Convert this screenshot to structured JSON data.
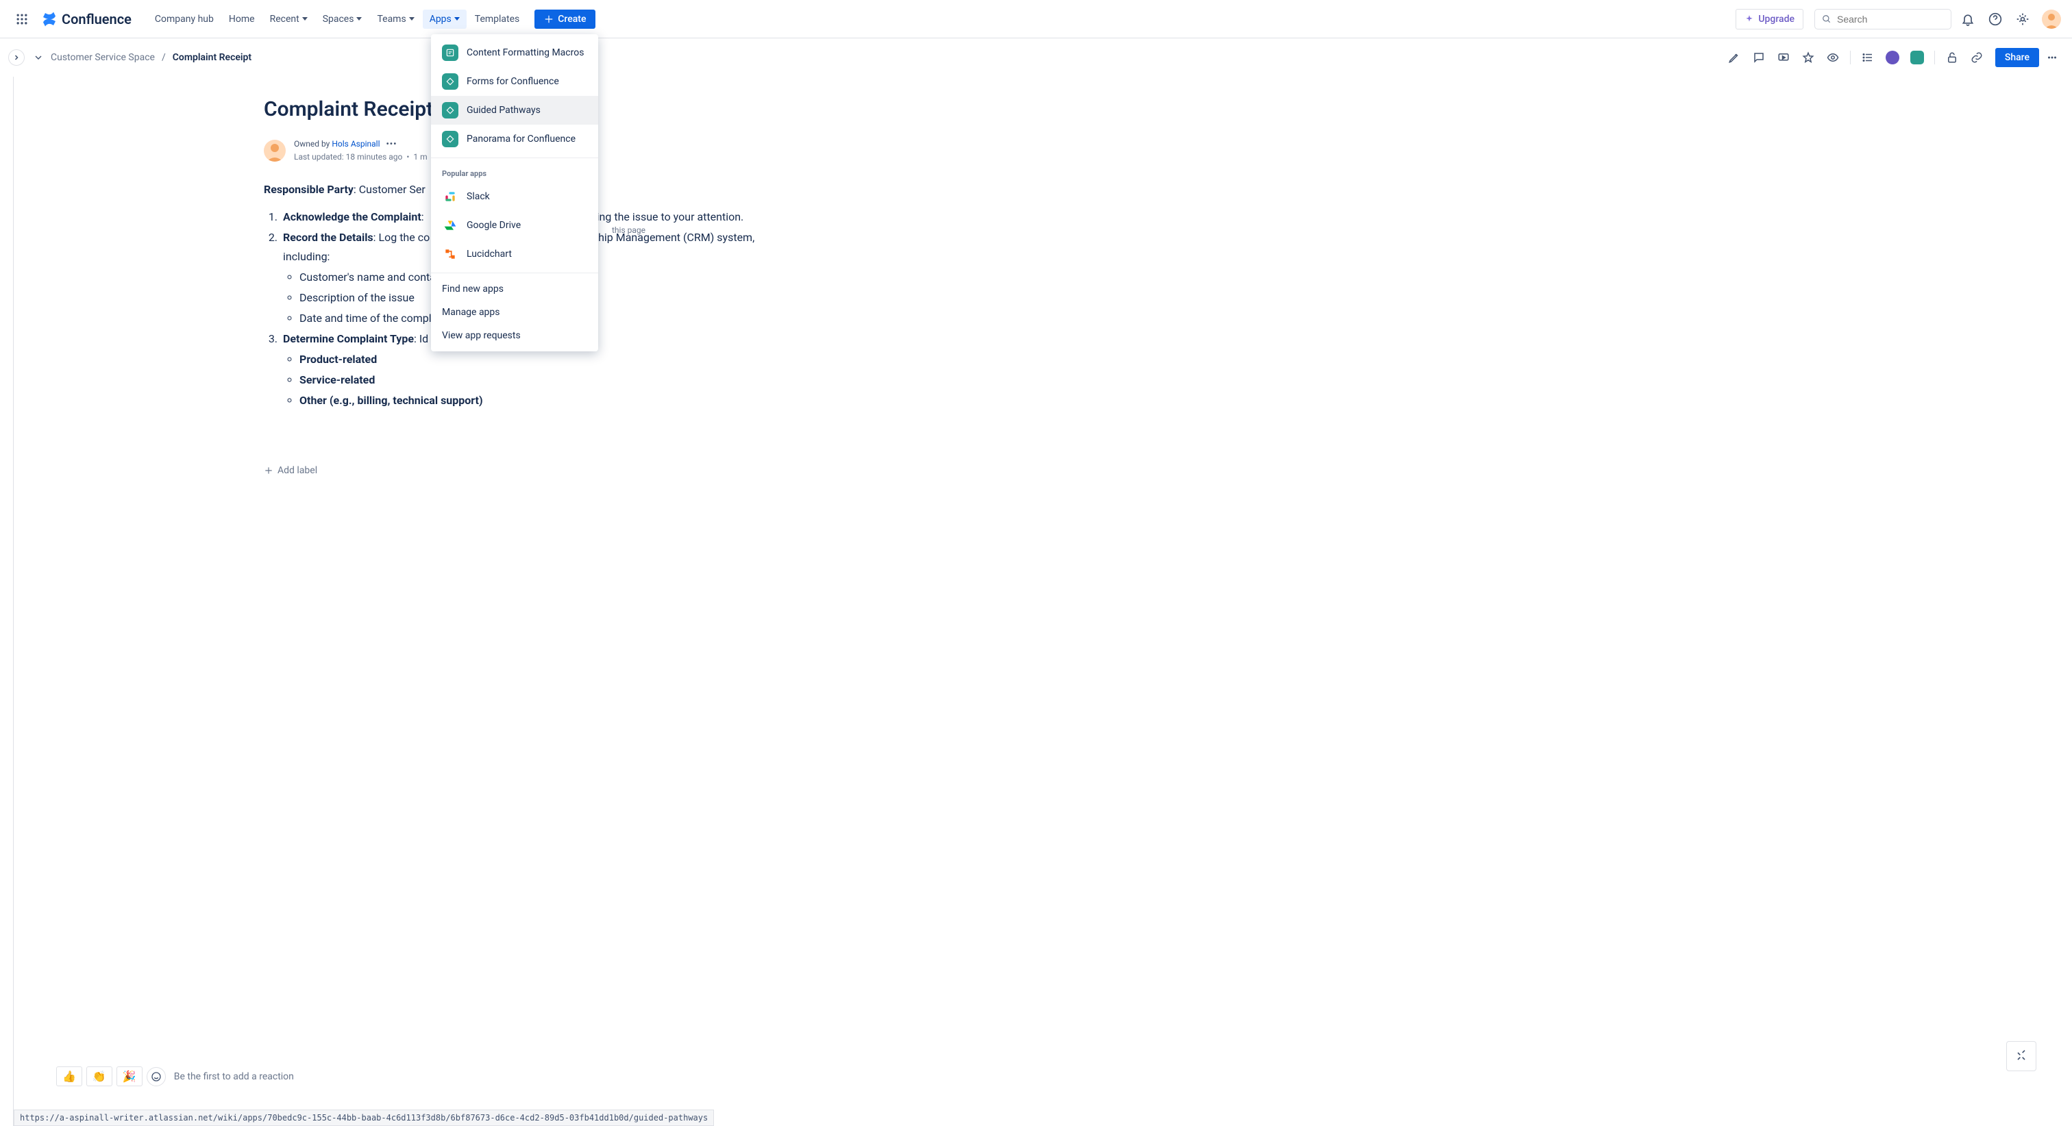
{
  "nav": {
    "logo_text": "Confluence",
    "company_hub": "Company hub",
    "home": "Home",
    "recent": "Recent",
    "spaces": "Spaces",
    "teams": "Teams",
    "apps": "Apps",
    "templates": "Templates",
    "create": "Create",
    "upgrade": "Upgrade",
    "search_placeholder": "Search"
  },
  "breadcrumb": {
    "space": "Customer Service Space",
    "separator": "/",
    "page": "Complaint Receipt"
  },
  "page_actions": {
    "share": "Share"
  },
  "page": {
    "title": "Complaint Receipt",
    "owned_by_prefix": "Owned by ",
    "owner_name": "Hols Aspinall",
    "last_updated": "Last updated: 18 minutes ago",
    "read_time_sep": "•",
    "read_time": "1 m",
    "analytics_suffix": "this page",
    "add_label": "Add label"
  },
  "content": {
    "resp_party_label": "Responsible Party",
    "resp_party_value": ": Customer Ser",
    "item1_label": "Acknowledge the Complaint",
    "item1_tail_visible": ": ",
    "item1_after_menu": "nging the issue to your attention.",
    "item2_label": "Record the Details",
    "item2_tail_visible": ": Log the co",
    "item2_after_menu": "hip Management (CRM) system, including:",
    "item2_sub1": "Customer's name and conta",
    "item2_sub2": "Description of the issue",
    "item2_sub3": "Date and time of the compla",
    "item3_label": "Determine Complaint Type",
    "item3_tail_visible": ": Id",
    "item3_sub1": "Product-related",
    "item3_sub2": "Service-related",
    "item3_sub3": "Other (e.g., billing, technical support)"
  },
  "apps_menu": {
    "items": [
      "Content Formatting Macros",
      "Forms for Confluence",
      "Guided Pathways",
      "Panorama for Confluence"
    ],
    "popular_label": "Popular apps",
    "popular": [
      "Slack",
      "Google Drive",
      "Lucidchart"
    ],
    "footer": [
      "Find new apps",
      "Manage apps",
      "View app requests"
    ]
  },
  "reactions": {
    "thumbs_up": "👍",
    "clap": "👏",
    "party": "🎉",
    "prompt": "Be the first to add a reaction"
  },
  "status_url": "https://a-aspinall-writer.atlassian.net/wiki/apps/70bedc9c-155c-44bb-baab-4c6d113f3d8b/6bf87673-d6ce-4cd2-89d5-03fb41dd1b0d/guided-pathways",
  "colors": {
    "primary": "#0C66E4",
    "text": "#172B4D",
    "muted": "#6B778C"
  }
}
